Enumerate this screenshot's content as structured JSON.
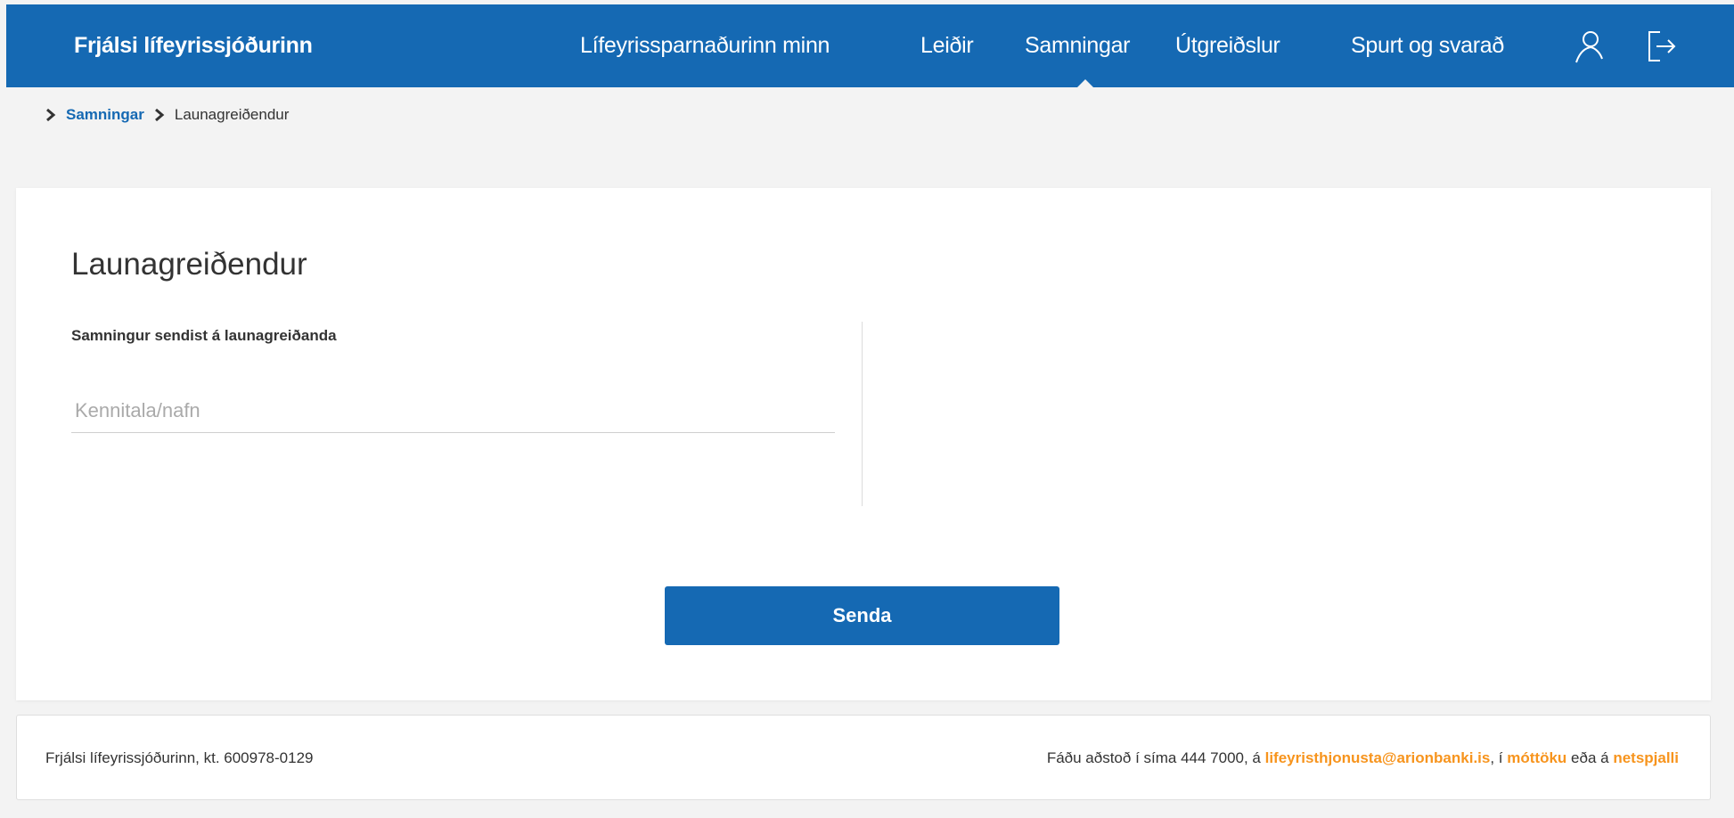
{
  "header": {
    "brand": "Frjálsi lífeyrissjóðurinn",
    "nav": [
      {
        "label": "Lífeyrissparnaðurinn minn"
      },
      {
        "label": "Leiðir"
      },
      {
        "label": "Samningar",
        "active": true
      },
      {
        "label": "Útgreiðslur"
      },
      {
        "label": "Spurt og svarað"
      }
    ],
    "icons": [
      "user-icon",
      "logout-icon"
    ],
    "bg_color": "#1569b3"
  },
  "breadcrumb": {
    "items": [
      {
        "label": "Samningar"
      },
      {
        "label": "Launagreiðendur"
      }
    ]
  },
  "main": {
    "title": "Launagreiðendur",
    "field_label": "Samningur sendist á launagreiðanda",
    "input": {
      "value": "",
      "placeholder": "Kennitala/nafn"
    },
    "send_label": "Senda"
  },
  "footer": {
    "left": "Frjálsi lífeyrissjóðurinn, kt. 600978-0129",
    "right_prefix": "Fáðu aðstoð í síma 444 7000, á ",
    "email": "lifeyristhjonusta@arionbanki.is",
    "sep1": ", í ",
    "reception": "móttöku",
    "sep2": " eða á ",
    "chat": "netspjalli",
    "link_color": "#f7941d"
  }
}
